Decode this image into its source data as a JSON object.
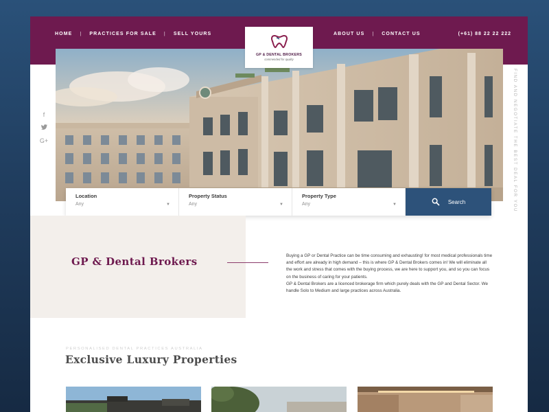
{
  "nav": {
    "left": [
      {
        "label": "HOME"
      },
      {
        "label": "PRACTICES FOR SALE"
      },
      {
        "label": "SELL YOURS"
      }
    ],
    "separator": "|",
    "right": [
      {
        "label": "ABOUT US"
      },
      {
        "label": "CONTACT US"
      }
    ],
    "phone": "(+61) 88 22 22 222"
  },
  "logo": {
    "name": "GP & DENTAL BROKERS",
    "tagline": "commended for quality",
    "icon": "tooth-icon"
  },
  "social": [
    {
      "icon": "facebook-icon",
      "glyph": "f"
    },
    {
      "icon": "twitter-icon",
      "glyph": "🐦"
    },
    {
      "icon": "googleplus-icon",
      "glyph": "G+"
    }
  ],
  "side_tagline": "FIND AND NEGOTIATE THE BEST DEAL FOR YOU",
  "search": {
    "fields": [
      {
        "label": "Location",
        "value": "Any"
      },
      {
        "label": "Property Status",
        "value": "Any"
      },
      {
        "label": "Property Type",
        "value": "Any"
      }
    ],
    "button_label": "Search"
  },
  "intro": {
    "title": "GP & Dental Brokers",
    "paragraph1": "Buying a GP or Dental Practice can be time consuming and exhausting! for most medical professionals time and effort are already in high demand – this is where GP & Dental Brokers comes in! We will eliminate all the work and stress that comes with the buying process, we are here to support you, and so you can focus on the business of caring for your patients.",
    "paragraph2": "GP & Dental Brokers are a licenced brokerage firm which purely deals with the GP and Dental Sector. We handle Solo to Medium and large practices across Australia."
  },
  "listings": {
    "kicker": "PERSONALISED DENTAL PRACTICES AUSTRALIA",
    "title": "Exclusive Luxury Properties"
  },
  "colors": {
    "brand_plum": "#6e1a4f",
    "search_blue": "#2d527a",
    "panel_beige": "#f3efeb"
  }
}
